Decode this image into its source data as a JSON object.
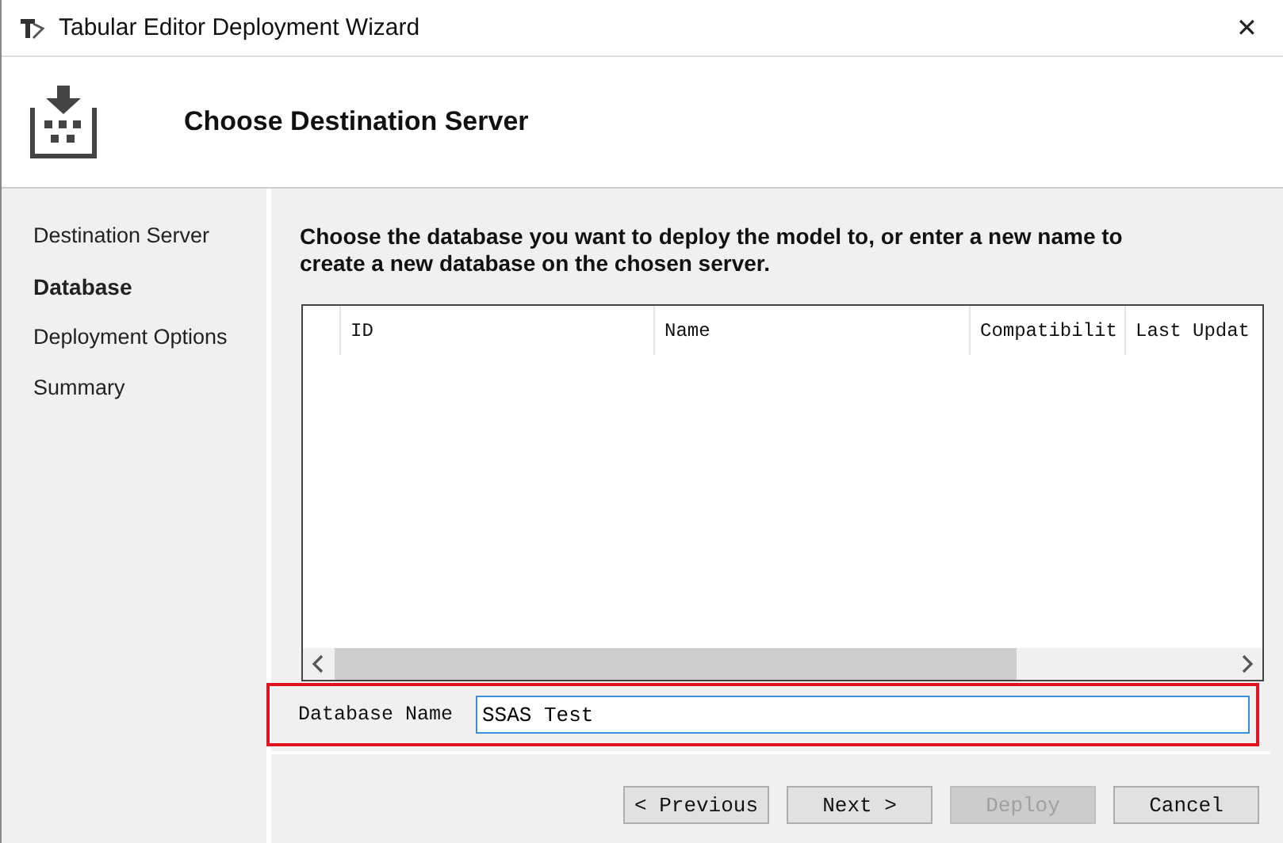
{
  "window": {
    "title": "Tabular Editor Deployment Wizard",
    "close": "✕"
  },
  "header": {
    "title": "Choose Destination Server"
  },
  "steps": [
    {
      "label": "Destination Server",
      "selected": false
    },
    {
      "label": "Database",
      "selected": true
    },
    {
      "label": "Deployment Options",
      "selected": false
    },
    {
      "label": "Summary",
      "selected": false
    }
  ],
  "instructions": "Choose the database you want to deploy the model to, or enter a new name to create a new database on the chosen server.",
  "table": {
    "columns": [
      "ID",
      "Name",
      "Compatibilit",
      "Last Updat"
    ]
  },
  "database_name": {
    "label": "Database Name",
    "value": "SSAS Test",
    "highlighted": true
  },
  "buttons": [
    {
      "label": "< Previous",
      "disabled": false
    },
    {
      "label": "Next >",
      "disabled": false
    },
    {
      "label": "Deploy",
      "disabled": true
    },
    {
      "label": "Cancel",
      "disabled": false
    }
  ]
}
